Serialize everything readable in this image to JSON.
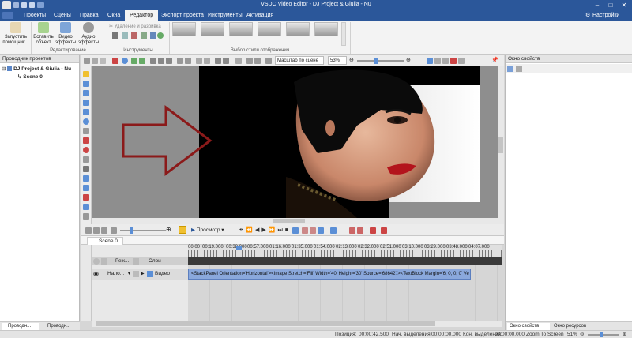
{
  "window": {
    "title": "VSDC Video Editor - DJ Project & Giulia - Nu"
  },
  "menu": {
    "items": [
      "Проекты",
      "Сцены",
      "Правка",
      "Окна",
      "Редактор",
      "Экспорт проекта",
      "Инструменты",
      "Активация"
    ],
    "active": "Редактор",
    "settings": "Настройки"
  },
  "ribbon": {
    "launch_wizard": "Запустить помощник...",
    "insert_object": "Вставить объект",
    "video_effects": "Видео эффекты",
    "audio_effects": "Аудио эффекты",
    "delete_split": "Удаление и разбивка",
    "group_editing": "Редактирование",
    "group_tools": "Инструменты",
    "group_style": "Выбор стиля отображения"
  },
  "left_panel": {
    "title": "Проводник проектов",
    "project": "DJ Project & Giulia - Nu",
    "scene": "Scene 0",
    "tab1": "Проводн...",
    "tab2": "Проводн..."
  },
  "right_panel": {
    "title": "Окно свойств",
    "tab1": "Окно свойств",
    "tab2": "Окно ресурсов"
  },
  "canvas_toolbar": {
    "zoom_label": "Масштаб по сцене",
    "zoom_value": "53%"
  },
  "timeline": {
    "preview_label": "Просмотр",
    "scene_tab": "Scene 0",
    "ticks": [
      "00:00",
      "00:19.000",
      "00:38.000",
      "00:57.000",
      "01:16.000",
      "01:35.000",
      "01:54.000",
      "02:13.000",
      "02:32.000",
      "02:51.000",
      "03:10.000",
      "03:29.000",
      "03:48.000",
      "04:07.000"
    ],
    "col_mode": "Реж...",
    "col_layers": "Слои",
    "row_mode": "Нало...",
    "row_layer": "Видео",
    "clip_text": "<StackPanel Orientation='Horizontal'><Image Stretch='Fill' Width='40' Height='30' Source='68642'/><TextBlock Margin='6, 0, 0, 0' Ve"
  },
  "status": {
    "position_label": "Позиция:",
    "position": "00:00:42.500",
    "sel_start_label": "Нач. выделения:",
    "sel_start": "00:00:00.000",
    "sel_end_label": "Кон. выделения:",
    "sel_end": "00:00:00.000",
    "zoom_label": "Zoom To Screen",
    "zoom": "51%"
  },
  "colors": {
    "titlebar": "#2b579a",
    "clip": "#8aa8dc",
    "playhead": "#d22020",
    "arrow": "#8b1a1a"
  }
}
